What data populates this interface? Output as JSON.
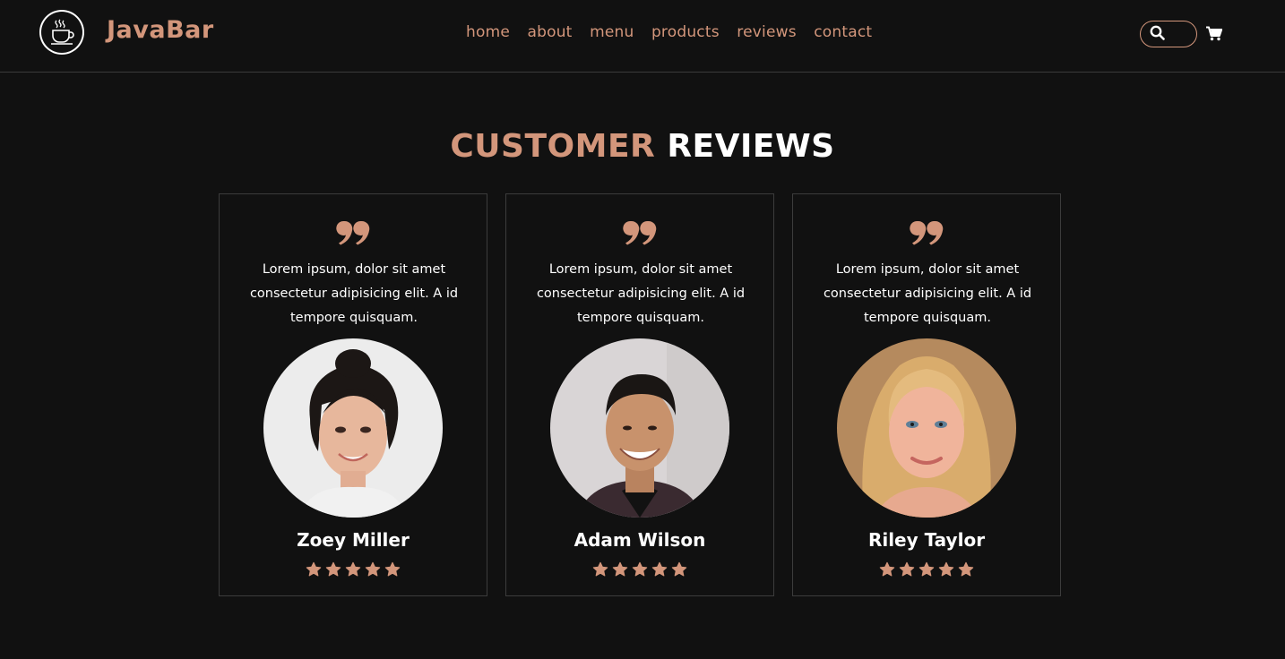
{
  "brand": {
    "name": "JavaBar",
    "logo_icon": "coffee-cup-icon"
  },
  "nav": {
    "items": [
      {
        "label": "home"
      },
      {
        "label": "about"
      },
      {
        "label": "menu"
      },
      {
        "label": "products"
      },
      {
        "label": "reviews"
      },
      {
        "label": "contact"
      }
    ]
  },
  "search": {
    "icon": "search-icon",
    "value": ""
  },
  "cart": {
    "icon": "shopping-cart-icon"
  },
  "section": {
    "title_accent": "CUSTOMER",
    "title_plain": "REVIEWS"
  },
  "reviews": [
    {
      "text": "Lorem ipsum, dolor sit amet consectetur adipisicing elit. A id tempore quisquam.",
      "name": "Zoey Miller",
      "rating": 5,
      "avatar": "woman-dark-hair-portrait"
    },
    {
      "text": "Lorem ipsum, dolor sit amet consectetur adipisicing elit. A id tempore quisquam.",
      "name": "Adam Wilson",
      "rating": 5,
      "avatar": "man-short-hair-portrait"
    },
    {
      "text": "Lorem ipsum, dolor sit amet consectetur adipisicing elit. A id tempore quisquam.",
      "name": "Riley Taylor",
      "rating": 5,
      "avatar": "woman-blonde-hair-portrait"
    }
  ],
  "colors": {
    "accent": "#d3967b",
    "background": "#111111",
    "border": "#3c3c3c",
    "text": "#ffffff"
  }
}
